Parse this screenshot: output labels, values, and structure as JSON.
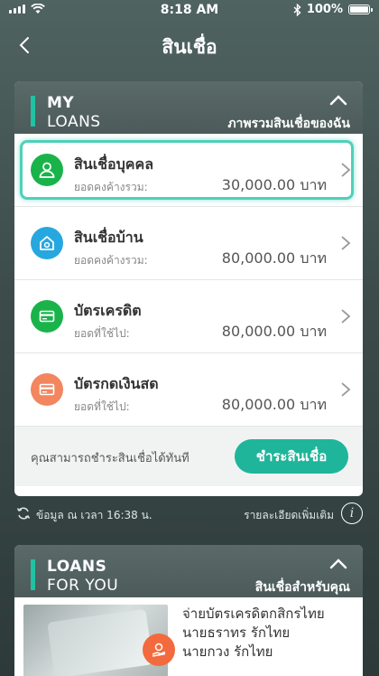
{
  "status": {
    "time": "8:18 AM",
    "battery": "100%"
  },
  "header": {
    "title": "สินเชื่อ"
  },
  "my_loans": {
    "title_line1": "MY",
    "title_line2": "LOANS",
    "overview_link": "ภาพรวมสินเชื่อของฉัน",
    "items": [
      {
        "name": "สินเชื่อบุคคล",
        "sub_label": "ยอดคงค้างรวม:",
        "amount": "30,000.00 บาท",
        "icon": "person-icon",
        "color": "#19b34a"
      },
      {
        "name": "สินเชื่อบ้าน",
        "sub_label": "ยอดคงค้างรวม:",
        "amount": "80,000.00 บาท",
        "icon": "house-icon",
        "color": "#27a7df"
      },
      {
        "name": "บัตรเครดิต",
        "sub_label": "ยอดที่ใช้ไป:",
        "amount": "80,000.00 บาท",
        "icon": "credit-card-icon",
        "color": "#19b34a"
      },
      {
        "name": "บัตรกดเงินสด",
        "sub_label": "ยอดที่ใช้ไป:",
        "amount": "80,000.00 บาท",
        "icon": "cash-card-icon",
        "color": "#f2865f"
      }
    ],
    "pay_text": "คุณสามารถชำระสินเชื่อได้ทันที",
    "pay_button": "ชำระสินเชื่อ"
  },
  "info": {
    "update_text": "ข้อมูล ณ เวลา 16:38 น.",
    "more_text": "รายละเอียดเพิ่มเติม"
  },
  "loans_for_you": {
    "title_line1": "LOANS",
    "title_line2": "FOR YOU",
    "right_link": "สินเชื่อสำหรับคุณ",
    "promo_line1": "จ่ายบัตรเครดิตกสิกรไทย",
    "promo_line2": "นายธราทร รักไทย",
    "promo_line3": "นายกวง รักไทย"
  },
  "colors": {
    "accent": "#1fc3a3",
    "pay_button": "#1fb59a"
  }
}
